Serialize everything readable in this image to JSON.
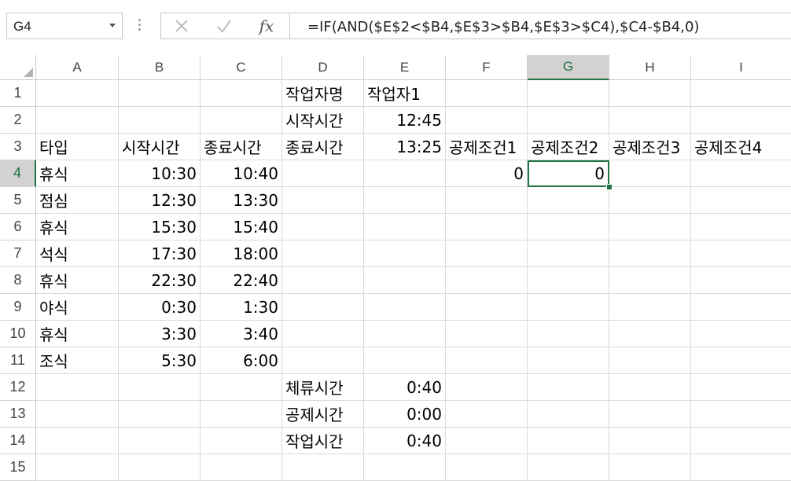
{
  "name_box": "G4",
  "formula": "=IF(AND($E$2<$B4,$E$3>$B4,$E$3>$C4),$C4-$B4,0)",
  "icons": {
    "cancel": "close-icon",
    "enter": "check-icon",
    "fx": "function-icon"
  },
  "toolbar": {
    "fx_label": "fx"
  },
  "columns": [
    "A",
    "B",
    "C",
    "D",
    "E",
    "F",
    "G",
    "H",
    "I"
  ],
  "rows": [
    "1",
    "2",
    "3",
    "4",
    "5",
    "6",
    "7",
    "8",
    "9",
    "10",
    "11",
    "12",
    "13",
    "14",
    "15"
  ],
  "cells": {
    "D1": "작업자명",
    "E1": "작업자1",
    "D2": "시작시간",
    "E2": "12:45",
    "A3": "타입",
    "B3": "시작시간",
    "C3": "종료시간",
    "D3": "종료시간",
    "E3": "13:25",
    "F3": "공제조건1",
    "G3": "공제조건2",
    "H3": "공제조건3",
    "I3": "공제조건4",
    "A4": "휴식",
    "B4": "10:30",
    "C4": "10:40",
    "F4": "0",
    "G4": "0",
    "A5": "점심",
    "B5": "12:30",
    "C5": "13:30",
    "A6": "휴식",
    "B6": "15:30",
    "C6": "15:40",
    "A7": "석식",
    "B7": "17:30",
    "C7": "18:00",
    "A8": "휴식",
    "B8": "22:30",
    "C8": "22:40",
    "A9": "야식",
    "B9": "0:30",
    "C9": "1:30",
    "A10": "휴식",
    "B10": "3:30",
    "C10": "3:40",
    "A11": "조식",
    "B11": "5:30",
    "C11": "6:00",
    "D12": "체류시간",
    "E12": "0:40",
    "D13": "공제시간",
    "E13": "0:00",
    "D14": "작업시간",
    "E14": "0:40"
  },
  "selected_cell": "G4",
  "colors": {
    "accent": "#217346",
    "header_selected_bg": "#d2d2d2"
  }
}
